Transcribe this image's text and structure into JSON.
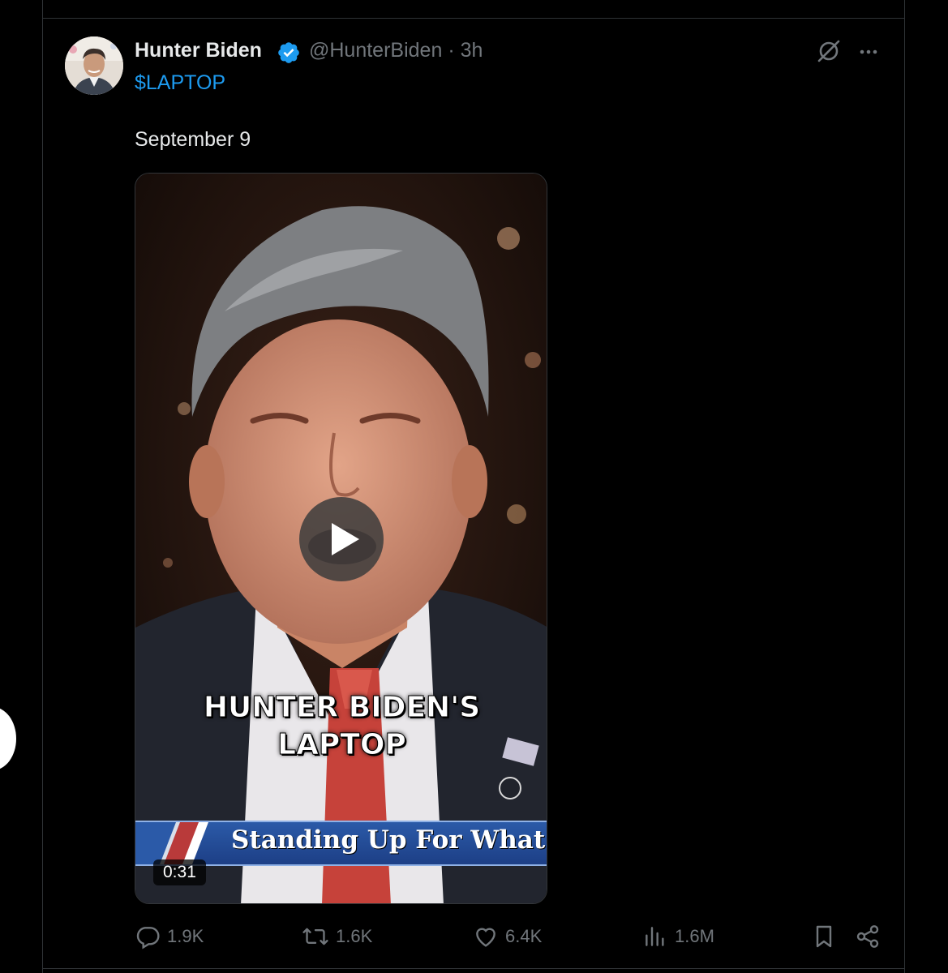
{
  "tweet": {
    "author_name": "Hunter Biden",
    "handle": "@HunterBiden",
    "separator": "·",
    "time": "3h",
    "text": "$LAPTOP",
    "subtext": "September 9"
  },
  "video": {
    "caption_line1": "HUNTER BIDEN'S",
    "caption_line2": "LAPTOP",
    "chyron": "Standing Up For What's Ri",
    "duration": "0:31"
  },
  "actions": {
    "replies": "1.9K",
    "reposts": "1.6K",
    "likes": "6.4K",
    "views": "1.6M"
  },
  "colors": {
    "background": "#000000",
    "accent": "#1d9bf0",
    "muted": "#71767b",
    "text": "#e7e9ea"
  },
  "icons": [
    "verified-badge-icon",
    "grok-icon",
    "more-icon",
    "play-icon",
    "reply-icon",
    "repost-icon",
    "like-icon",
    "views-icon",
    "bookmark-icon",
    "share-icon"
  ]
}
